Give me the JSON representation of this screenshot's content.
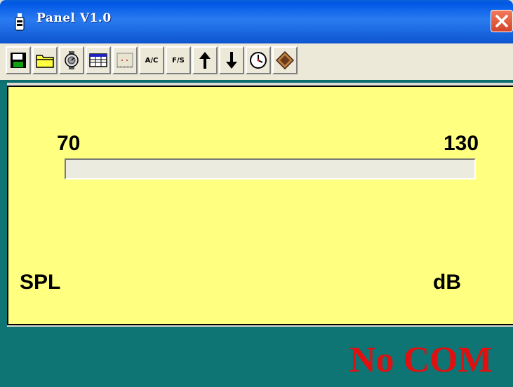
{
  "window": {
    "title": "Panel  V1.0"
  },
  "toolbar": {
    "buttons": [
      {
        "name": "save",
        "icon": "floppy-disk-icon"
      },
      {
        "name": "open",
        "icon": "folder-icon"
      },
      {
        "name": "watch",
        "icon": "watch-icon"
      },
      {
        "name": "table",
        "icon": "table-icon"
      },
      {
        "name": "chart",
        "icon": "chart-paper-icon"
      },
      {
        "name": "ac",
        "label": "A/C"
      },
      {
        "name": "fs",
        "label": "F/S"
      },
      {
        "name": "up",
        "icon": "arrow-up-icon"
      },
      {
        "name": "down",
        "icon": "arrow-down-icon"
      },
      {
        "name": "clock",
        "icon": "clock-icon"
      },
      {
        "name": "exit",
        "icon": "diamond-icon"
      }
    ]
  },
  "meter": {
    "scale_min": "70",
    "scale_max": "130",
    "level_percent": 0,
    "quantity": "SPL",
    "unit": "dB"
  },
  "status": {
    "text": "No COM"
  },
  "colors": {
    "panel_bg": "#ffff80",
    "status_bg": "#0e7474",
    "status_text": "#e01010",
    "titlebar": "#0058e6"
  }
}
